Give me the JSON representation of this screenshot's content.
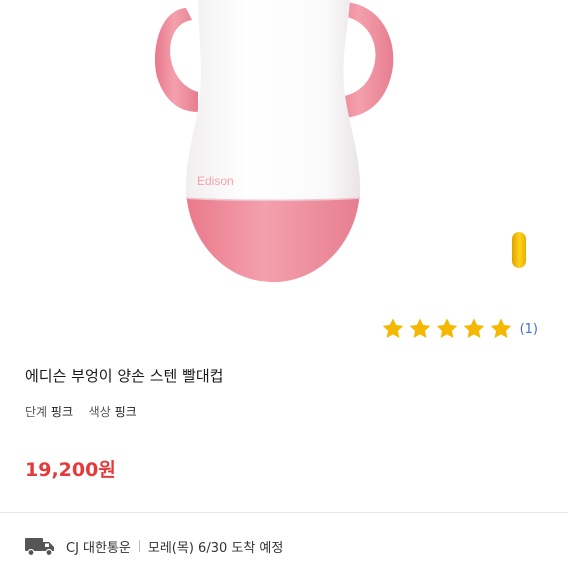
{
  "product": {
    "brand_print": "Edison",
    "rating": {
      "stars": 5,
      "max": 5,
      "review_count": "(1)",
      "star_color": "#f5b800"
    },
    "title": "에디슨 부엉이 양손 스텐 빨대컵",
    "options": [
      {
        "label": "단계",
        "value": "핑크"
      },
      {
        "label": "색상",
        "value": "핑크"
      }
    ],
    "price": "19,200원",
    "price_color": "#e53a3a",
    "cup_colors": {
      "pink": "#f2909f",
      "white": "#ffffff"
    }
  },
  "delivery": {
    "icon": "truck-icon",
    "carrier": "CJ 대한통운",
    "eta": "모레(목) 6/30 도착 예정"
  }
}
